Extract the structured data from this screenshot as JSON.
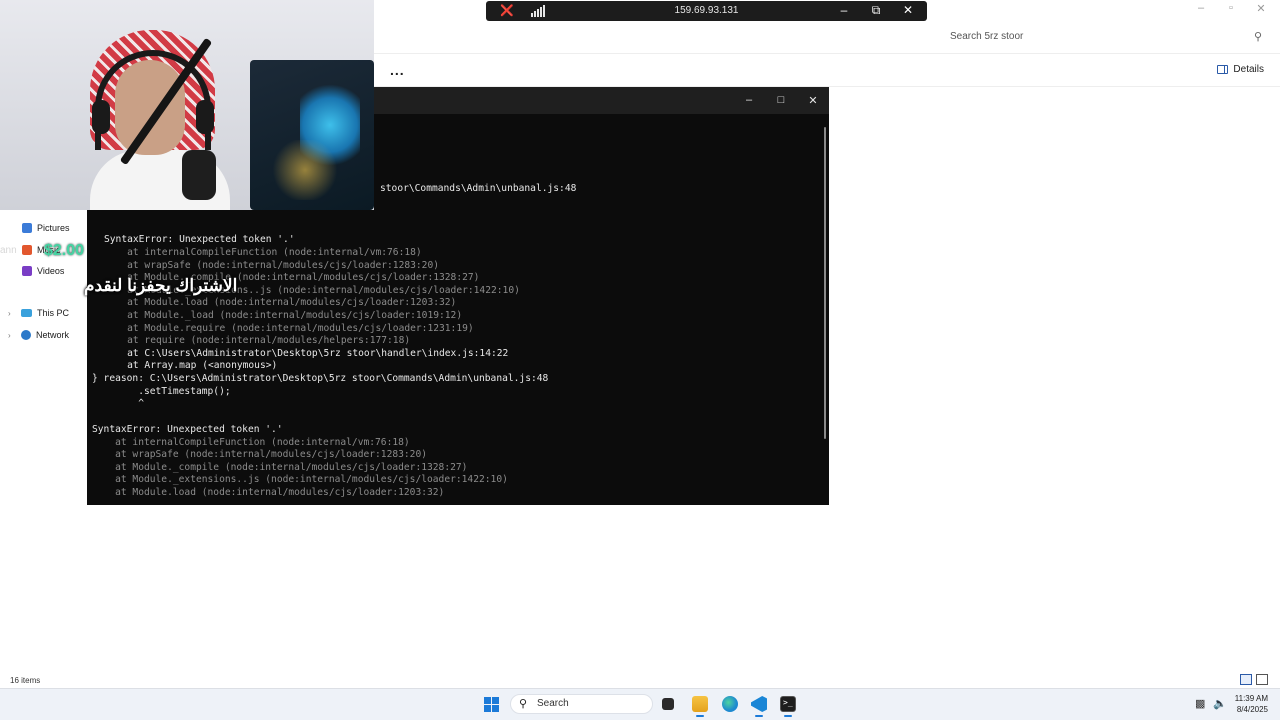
{
  "remote_bar": {
    "ip": "159.69.93.131",
    "pin_icon": "pin-off-icon",
    "signal_icon": "signal-icon",
    "minimize_icon": "minimize-icon",
    "restore_icon": "restore-icon",
    "close_icon": "close-icon"
  },
  "explorer": {
    "search_placeholder": "Search 5rz stoor",
    "more_label": "...",
    "details_label": "Details",
    "sidebar": [
      {
        "label": "Pictures",
        "icon": "pictures-icon"
      },
      {
        "label": "Music",
        "icon": "music-icon"
      },
      {
        "label": "Videos",
        "icon": "videos-icon"
      },
      {
        "label": "This PC",
        "icon": "this-pc-icon"
      },
      {
        "label": "Network",
        "icon": "network-icon"
      }
    ],
    "status": "16 items"
  },
  "terminal": {
    "lines": [
      "stoor\\Commands\\Admin\\unbanal.js:48",
      "^",
      "SyntaxError: Unexpected token '.'",
      "    at internalCompileFunction (node:internal/vm:76:18)",
      "    at wrapSafe (node:internal/modules/cjs/loader:1283:20)",
      "    at Module._compile (node:internal/modules/cjs/loader:1328:27)",
      "    at Module._extensions..js (node:internal/modules/cjs/loader:1422:10)",
      "    at Module.load (node:internal/modules/cjs/loader:1203:32)",
      "    at Module._load (node:internal/modules/cjs/loader:1019:12)",
      "    at Module.require (node:internal/modules/cjs/loader:1231:19)",
      "    at require (node:internal/modules/helpers:177:18)",
      "    at C:\\Users\\Administrator\\Desktop\\5rz stoor\\handler\\index.js:14:22",
      "    at Array.map (<anonymous>)",
      "} reason: C:\\Users\\Administrator\\Desktop\\5rz stoor\\Commands\\Admin\\unbanal.js:48",
      "        .setTimestamp();",
      "        ^",
      "SyntaxError: Unexpected token '.'",
      "    at internalCompileFunction (node:internal/vm:76:18)",
      "    at wrapSafe (node:internal/modules/cjs/loader:1283:20)",
      "    at Module._compile (node:internal/modules/cjs/loader:1328:27)",
      "    at Module._extensions..js (node:internal/modules/cjs/loader:1422:10)",
      "    at Module.load (node:internal/modules/cjs/loader:1203:32)"
    ]
  },
  "overlay": {
    "amount": "$2.00",
    "faint_text": "ann",
    "arabic_text": "الاشتراك يحفزنا لنقدم"
  },
  "taskbar": {
    "search_label": "Search",
    "time": "11:39 AM",
    "date": "8/4/2025"
  }
}
